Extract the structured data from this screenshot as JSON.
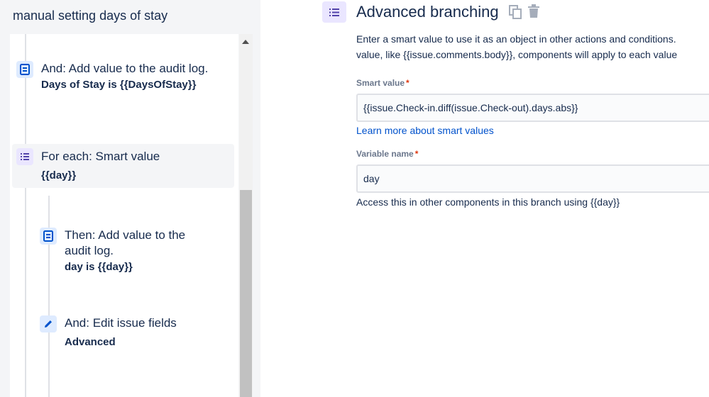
{
  "rule": {
    "title": "manual setting days of stay"
  },
  "components": [
    {
      "title": "And: Add value to the audit log.",
      "detail": "Days of Stay is {{DaysOfStay}}",
      "icon": "audit-log-icon"
    },
    {
      "title": "For each: Smart value",
      "detail": "{{day}}",
      "icon": "branch-list-icon"
    },
    {
      "title": "Then: Add value to the audit log.",
      "detail": "day is {{day}}",
      "icon": "audit-log-icon"
    },
    {
      "title": "And: Edit issue fields",
      "detail": "Advanced",
      "icon": "edit-pencil-icon"
    }
  ],
  "details": {
    "title": "Advanced branching",
    "description_line1": "Enter a smart value to use it as an object in other actions and conditions.",
    "description_line2": "value, like {{issue.comments.body}}, components will apply to each value",
    "smart_value_label": "Smart value",
    "smart_value": "{{issue.Check-in.diff(issue.Check-out).days.abs}}",
    "learn_more": "Learn more about smart values",
    "variable_name_label": "Variable name",
    "variable_name": "day",
    "help_text": "Access this in other components in this branch using {{day}}",
    "required_marker": "*"
  },
  "colors": {
    "accent": "#0052cc",
    "icon_bg_blue": "#deebff",
    "icon_bg_purple": "#eae6ff",
    "required": "#de350b"
  }
}
